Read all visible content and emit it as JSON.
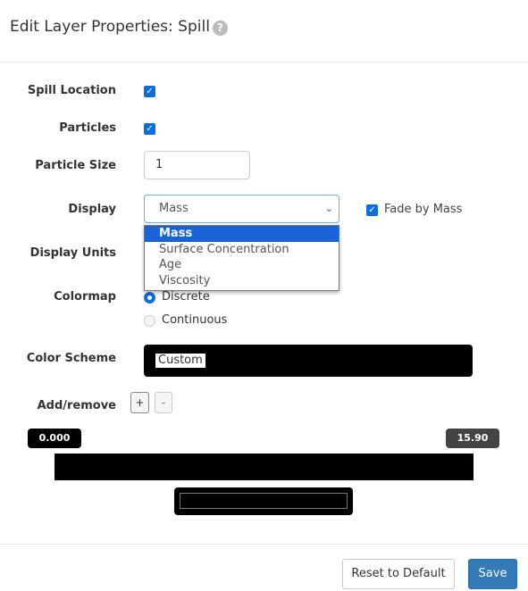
{
  "header": {
    "title": "Edit Layer Properties: Spill",
    "help_icon": "?"
  },
  "form": {
    "spill_location": {
      "label": "Spill Location",
      "checked": true
    },
    "particles": {
      "label": "Particles",
      "checked": true
    },
    "particle_size": {
      "label": "Particle Size",
      "value": "1"
    },
    "display": {
      "label": "Display",
      "value": "Mass",
      "options": [
        "Mass",
        "Surface Concentration",
        "Age",
        "Viscosity"
      ],
      "fade_label": "Fade by Mass",
      "fade_checked": true
    },
    "display_units": {
      "label": "Display Units"
    },
    "colormap": {
      "label": "Colormap",
      "options": [
        "Discrete",
        "Continuous"
      ],
      "selected": "Discrete"
    },
    "color_scheme": {
      "label": "Color Scheme",
      "value": "Custom"
    },
    "add_remove": {
      "label": "Add/remove",
      "add": "+",
      "remove": "-"
    },
    "range": {
      "min": "0.000",
      "max": "15.90",
      "bar_color": "#000000"
    }
  },
  "footer": {
    "reset": "Reset to Default",
    "save": "Save",
    "save_color": "#337ab7"
  }
}
